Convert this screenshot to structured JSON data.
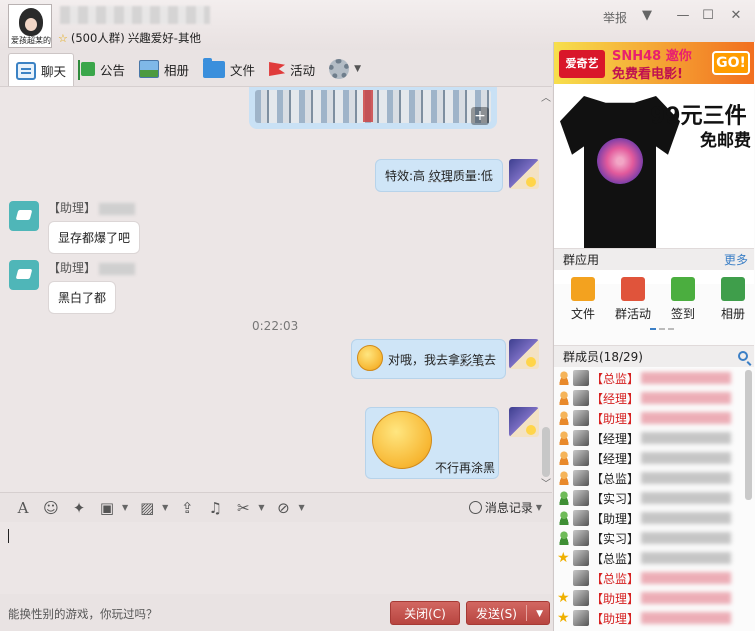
{
  "window": {
    "group_avatar_caption": "爱孩超某的",
    "group_member_count": "(500人群)",
    "group_category": "兴趣爱好-其他",
    "report_label": "举报"
  },
  "tabs": [
    {
      "label": "聊天",
      "icon": "chat-icon"
    },
    {
      "label": "公告",
      "icon": "notice-flag-icon"
    },
    {
      "label": "相册",
      "icon": "album-icon"
    },
    {
      "label": "文件",
      "icon": "folder-icon"
    },
    {
      "label": "活动",
      "icon": "event-flag-icon"
    }
  ],
  "messages": {
    "m1_text_a": "特效:高 ",
    "m1_text_b": "纹理",
    "m1_text_c": "质量:低",
    "m2_sender": "【助理】",
    "m2_text": "显存都爆了吧",
    "m3_sender": "【助理】",
    "m3_text": "黑白了都",
    "timestamp": "0:22:03",
    "m4_text_a": "对哦，我去拿",
    "m4_text_b": "彩笔",
    "m4_text_c": "去",
    "m5_text": "不行再涂黑"
  },
  "composer": {
    "history_label": "消息记录",
    "promo_text": "能换性别的游戏，你玩过吗？",
    "close_label": "关闭(C)",
    "send_label": "发送(S)"
  },
  "ads": {
    "banner_logo": "爱奇艺",
    "banner_line1": "SNH48 邀你",
    "banner_line2": "免费看电影!",
    "banner_go": "GO!",
    "tshirt_price": "99元三件",
    "tshirt_shipping": "免邮费"
  },
  "group_apps": {
    "title": "群应用",
    "more": "更多",
    "items": [
      "文件",
      "群活动",
      "签到",
      "相册"
    ]
  },
  "members": {
    "title": "群成员(18/29)",
    "list": [
      {
        "role": "【总监】",
        "red": true,
        "badge": "person"
      },
      {
        "role": "【经理】",
        "red": true,
        "badge": "person"
      },
      {
        "role": "【助理】",
        "red": true,
        "badge": "person"
      },
      {
        "role": "【经理】",
        "red": false,
        "badge": "person"
      },
      {
        "role": "【经理】",
        "red": false,
        "badge": "person"
      },
      {
        "role": "【总监】",
        "red": false,
        "badge": "person"
      },
      {
        "role": "【实习】",
        "red": false,
        "badge": "person-green"
      },
      {
        "role": "【助理】",
        "red": false,
        "badge": "person-green"
      },
      {
        "role": "【实习】",
        "red": false,
        "badge": "person-green"
      },
      {
        "role": "【总监】",
        "red": false,
        "badge": "star"
      },
      {
        "role": "【总监】",
        "red": true,
        "badge": "none"
      },
      {
        "role": "【助理】",
        "red": true,
        "badge": "star"
      },
      {
        "role": "【助理】",
        "red": true,
        "badge": "star"
      }
    ]
  }
}
